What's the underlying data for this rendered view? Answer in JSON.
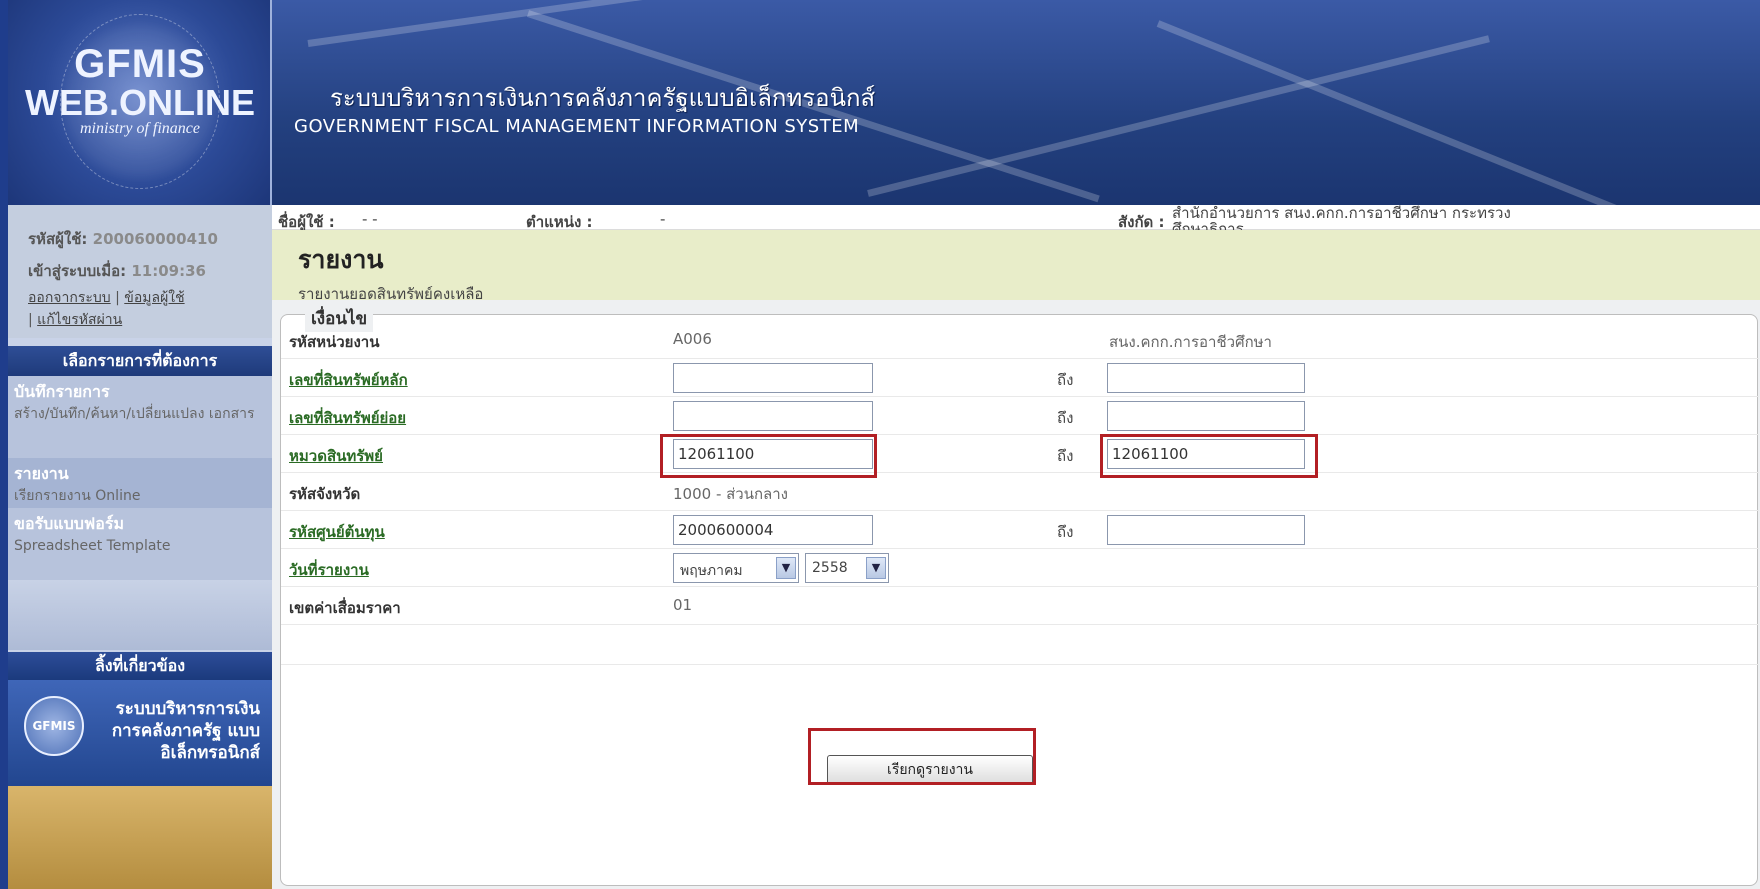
{
  "header": {
    "logo_line1": "GFMIS",
    "logo_line2": "WEB.ONLINE",
    "logo_line3": "ministry of finance",
    "title_th": "ระบบบริหารการเงินการคลังภาครัฐแบบอิเล็กทรอนิกส์",
    "title_en": "GOVERNMENT FISCAL MANAGEMENT INFORMATION SYSTEM"
  },
  "sidebar": {
    "user_id_label": "รหัสผู้ใช้:",
    "user_id_value": "200060000410",
    "login_label": "เข้าสู่ระบบเมื่อ:",
    "login_time": "11:09:36",
    "link_logout": "ออกจากระบบ",
    "link_profile": "ข้อมูลผู้ใช้",
    "link_password": "แก้ไขรหัสผ่าน",
    "sep": "|",
    "menu_heading": "เลือกรายการที่ต้องการ",
    "menu": [
      {
        "title": "บันทึกรายการ",
        "sub": "สร้าง/บันทึก/ค้นหา/เปลี่ยนแปลง เอกสาร"
      },
      {
        "title": "รายงาน",
        "sub": "เรียกรายงาน Online"
      },
      {
        "title": "ขอรับแบบฟอร์ม",
        "sub": "Spreadsheet Template"
      }
    ],
    "links_heading": "ลิ้งที่เกี่ยวข้อง",
    "banner1_logo": "GFMIS",
    "banner1_text": "ระบบบริหารการเงิน การคลังภาครัฐ แบบอิเล็กทรอนิกส์"
  },
  "info_bar": {
    "user_label": "ชื่อผู้ใช้ :",
    "user_value": "- -",
    "position_label": "ตำแหน่ง :",
    "position_value": "-",
    "affiliation_label": "สังกัด :",
    "affiliation_line1": "สำนักอำนวยการ สนง.คกก.การอาชีวศึกษา กระทรวง",
    "affiliation_line2": "ศึกษาธิการ"
  },
  "page": {
    "title": "รายงาน",
    "subtitle": "รายงานยอดสินทรัพย์คงเหลือ"
  },
  "form": {
    "legend": "เงื่อนไข",
    "to_label": "ถึง",
    "rows": {
      "unit_code": {
        "label": "รหัสหน่วยงาน",
        "value": "A006",
        "desc": "สนง.คกก.การอาชีวศึกษา"
      },
      "asset_main": {
        "label": "เลขที่สินทรัพย์หลัก",
        "from": "",
        "to": ""
      },
      "asset_sub": {
        "label": "เลขที่สินทรัพย์ย่อย",
        "from": "",
        "to": ""
      },
      "asset_class": {
        "label": "หมวดสินทรัพย์",
        "from": "12061100",
        "to": "12061100"
      },
      "province": {
        "label": "รหัสจังหวัด",
        "value": "1000 - ส่วนกลาง"
      },
      "cost_center": {
        "label": "รหัสศูนย์ต้นทุน",
        "from": "2000600004",
        "to": ""
      },
      "report_date": {
        "label": "วันที่รายงาน",
        "month": "พฤษภาคม",
        "year": "2558"
      },
      "depreciation": {
        "label": "เขตค่าเสื่อมราคา",
        "value": "01"
      }
    },
    "submit_label": "เรียกดูรายงาน"
  },
  "colors": {
    "header_blue": "#23407f",
    "page_head_bg": "#e8edc9",
    "highlight_red": "#b21f24",
    "link_green": "#2a6b24"
  }
}
